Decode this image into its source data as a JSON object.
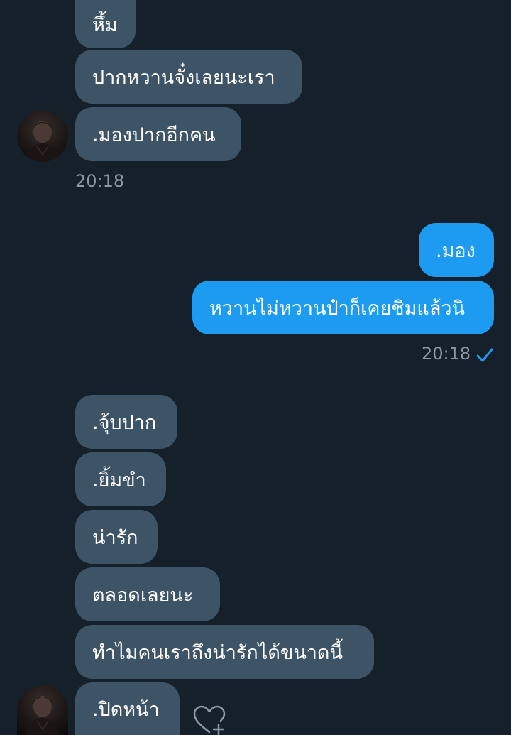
{
  "messages": [
    {
      "text": "หึ้ม",
      "direction": "incoming"
    },
    {
      "text": "ปากหวานจั๋งเลยนะเรา",
      "direction": "incoming"
    },
    {
      "text": ".มองปากอีกคน",
      "direction": "incoming"
    },
    {
      "text": ".มอง",
      "direction": "outgoing"
    },
    {
      "text": "หวานไม่หวานป๋าก็เคยชิมแล้วนิ",
      "direction": "outgoing"
    },
    {
      "text": ".จุ้บปาก",
      "direction": "incoming"
    },
    {
      "text": ".ยิ้มขำ",
      "direction": "incoming"
    },
    {
      "text": "น่ารัก",
      "direction": "incoming"
    },
    {
      "text": "ตลอดเลยนะ",
      "direction": "incoming"
    },
    {
      "text": "ทำไมคนเราถึงน่ารักได้ขนาดนี้",
      "direction": "incoming"
    },
    {
      "text": ".ปิดหน้า",
      "direction": "incoming"
    }
  ],
  "timestamps": {
    "incoming_group_1": "20:18",
    "outgoing_group_1": "20:18"
  },
  "icons": {
    "read_receipt": "check-icon",
    "react": "heart-add-icon"
  },
  "colors": {
    "background": "#15202b",
    "incoming_bubble": "#3d5466",
    "outgoing_bubble": "#1d9bf0",
    "timestamp": "#8b98a5",
    "check": "#1d9bf0",
    "heart": "#8b98a5"
  }
}
